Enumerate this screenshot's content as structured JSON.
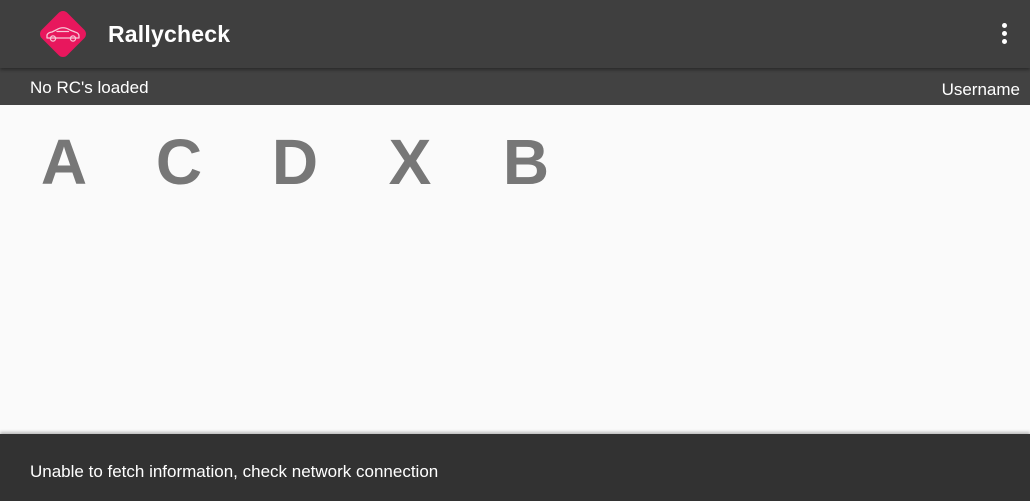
{
  "app_bar": {
    "title": "Rallycheck",
    "logo_icon": "car-icon",
    "logo_color": "#e8175d",
    "menu_icon": "more-vert-icon"
  },
  "status_bar": {
    "status": "No RC's loaded",
    "username": "Username"
  },
  "classes": [
    "A",
    "C",
    "D",
    "X",
    "B"
  ],
  "snackbar": {
    "message": "Unable to fetch information, check network connection"
  },
  "colors": {
    "app_bar": "#3f3f3f",
    "status_bar": "#424242",
    "background": "#fafafa",
    "letter": "#777777",
    "snackbar": "#323232"
  }
}
